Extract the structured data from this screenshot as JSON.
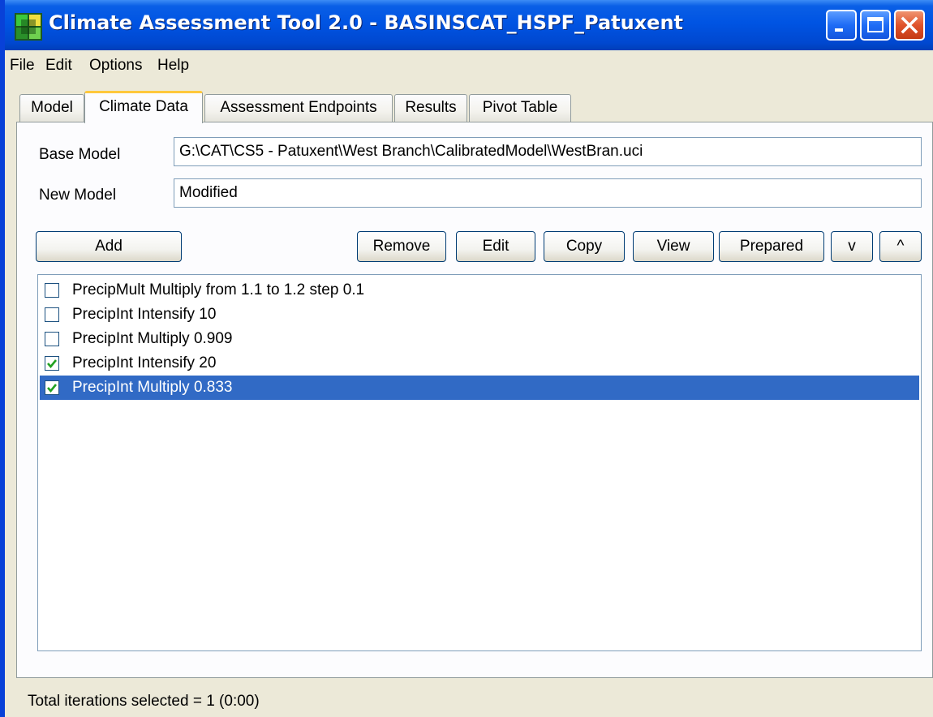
{
  "window": {
    "title": "Climate Assessment Tool 2.0 - BASINSCAT_HSPF_Patuxent"
  },
  "menu": [
    "File",
    "Edit",
    "Options",
    "Help"
  ],
  "tabs": [
    "Model",
    "Climate Data",
    "Assessment Endpoints",
    "Results",
    "Pivot Table"
  ],
  "active_tab": "Climate Data",
  "form": {
    "base_model_label": "Base Model",
    "base_model_value": "G:\\CAT\\CS5 - Patuxent\\West Branch\\CalibratedModel\\WestBran.uci",
    "new_model_label": "New Model",
    "new_model_value": "Modified"
  },
  "buttons": {
    "add": "Add",
    "remove": "Remove",
    "edit": "Edit",
    "copy": "Copy",
    "view": "View",
    "prepared": "Prepared",
    "down": "v",
    "up": "^"
  },
  "list": [
    {
      "text": "PrecipMult Multiply from 1.1 to 1.2 step 0.1",
      "checked": false,
      "selected": false
    },
    {
      "text": "PrecipInt Intensify 10",
      "checked": false,
      "selected": false
    },
    {
      "text": "PrecipInt Multiply 0.909",
      "checked": false,
      "selected": false
    },
    {
      "text": "PrecipInt Intensify 20",
      "checked": true,
      "selected": false
    },
    {
      "text": "PrecipInt Multiply 0.833",
      "checked": true,
      "selected": true
    }
  ],
  "status": "Total iterations selected = 1 (0:00)",
  "colors": {
    "selection": "#316ac5",
    "titlebar": "#0054e3",
    "check": "#21a121"
  }
}
